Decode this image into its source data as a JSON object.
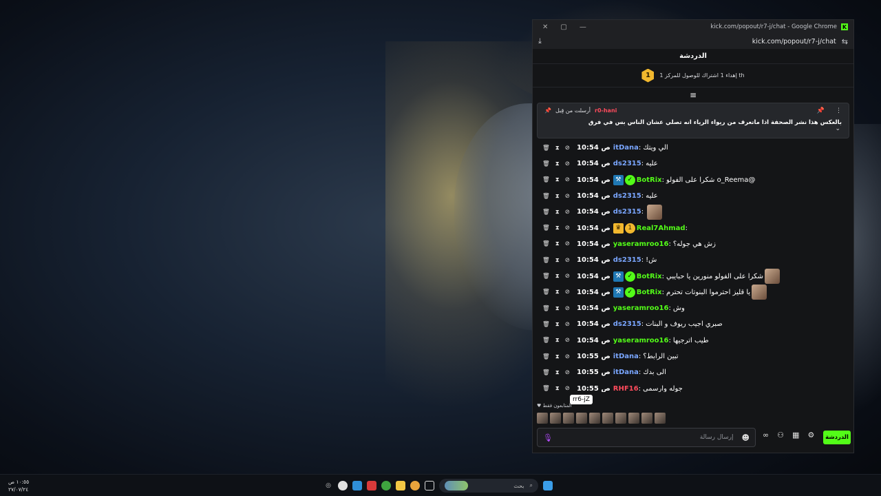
{
  "window": {
    "title": "kick.com/popout/r7-j/chat - Google Chrome",
    "url": "kick.com/popout/r7-j/chat",
    "min_label": "—",
    "max_label": "▢",
    "close_label": "✕"
  },
  "chat": {
    "header": "الدردشة",
    "goal_text": "إهداء 1 اشتراك للوصول للمركز 1 th",
    "goal_rank": "1",
    "pinned": {
      "by_label": "أرسلت من قِبل",
      "user": "r0-hani",
      "text": "بالعكس هذا نشر الصحفة اذا ماتعرف من ريواء الرياء انه تصلي عشان الناس بس في فرق"
    },
    "messages": [
      {
        "time": "10:54 ص",
        "user": "itDana",
        "color": "#7aa6ff",
        "text": "الي ويتك",
        "badges": [],
        "emote": false
      },
      {
        "time": "10:54 ص",
        "user": "ds2315",
        "color": "#7aa6ff",
        "text": "عليه",
        "badges": [],
        "emote": false
      },
      {
        "time": "10:54 ص",
        "user": "BotRix",
        "color": "#53fc18",
        "text": "@o_Reema شكرا على الفولو",
        "badges": [
          "bot",
          "verified"
        ],
        "emote": false
      },
      {
        "time": "10:54 ص",
        "user": "ds2315",
        "color": "#7aa6ff",
        "text": "عليه",
        "badges": [],
        "emote": false
      },
      {
        "time": "10:54 ص",
        "user": "ds2315",
        "color": "#7aa6ff",
        "text": "",
        "badges": [],
        "emote": true
      },
      {
        "time": "10:54 ص",
        "user": "Real7Ahmad",
        "color": "#53fc18",
        "text": "",
        "badges": [
          "crown",
          "sub"
        ],
        "emote": false
      },
      {
        "time": "10:54 ص",
        "user": "yaseramroo16",
        "color": "#53fc18",
        "text": "زش هي جوله؟",
        "badges": [],
        "emote": false
      },
      {
        "time": "10:54 ص",
        "user": "ds2315",
        "color": "#7aa6ff",
        "text": "ش!",
        "badges": [],
        "emote": false
      },
      {
        "time": "10:54 ص",
        "user": "BotRix",
        "color": "#53fc18",
        "text": "شكرا على الفولو منورين يا حبايبي",
        "badges": [
          "bot",
          "verified"
        ],
        "emote": true
      },
      {
        "time": "10:54 ص",
        "user": "BotRix",
        "color": "#53fc18",
        "text": "يا قليز احترموا البنوتات تحترم",
        "badges": [
          "bot",
          "verified"
        ],
        "emote": true
      },
      {
        "time": "10:54 ص",
        "user": "yaseramroo16",
        "color": "#53fc18",
        "text": "وش",
        "badges": [],
        "emote": false
      },
      {
        "time": "10:54 ص",
        "user": "ds2315",
        "color": "#7aa6ff",
        "text": "صبري اجيب ريوف و البنات",
        "badges": [],
        "emote": false
      },
      {
        "time": "10:54 ص",
        "user": "yaseramroo16",
        "color": "#53fc18",
        "text": "طيب اترجيها",
        "badges": [],
        "emote": false
      },
      {
        "time": "10:55 ص",
        "user": "itDana",
        "color": "#7aa6ff",
        "text": "تبين الرابط؟",
        "badges": [],
        "emote": false
      },
      {
        "time": "10:55 ص",
        "user": "itDana",
        "color": "#7aa6ff",
        "text": "الى بدك",
        "badges": [],
        "emote": false
      },
      {
        "time": "10:55 ص",
        "user": "RHF16",
        "color": "#ff4b5c",
        "text": "جوله وارسمي",
        "badges": [],
        "emote": false
      }
    ],
    "tooltip": "rr6-jZ",
    "viewers_label": "المتابعون فقط",
    "placeholder": "إرسال رسالة",
    "send_label": "الدردشة"
  },
  "taskbar": {
    "time": "١٠:٥٥ ص",
    "date": "٢٧/٠٧/٢٤",
    "search_label": "بحث"
  },
  "colors": {
    "accent": "#53fc18",
    "user_blue": "#7aa6ff",
    "user_red": "#ff4b5c",
    "gold": "#f2b82e"
  }
}
